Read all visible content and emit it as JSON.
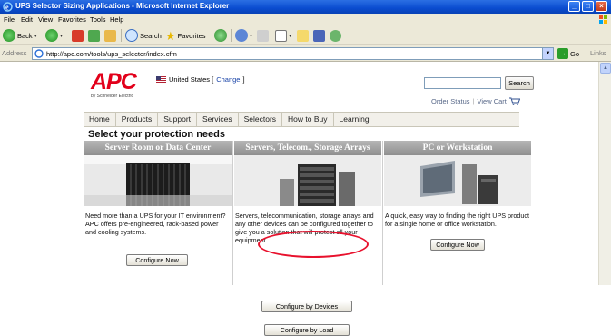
{
  "window": {
    "title": "UPS Selector Sizing Applications - Microsoft Internet Explorer"
  },
  "menu": [
    "File",
    "Edit",
    "View",
    "Favorites",
    "Tools",
    "Help"
  ],
  "toolbar": {
    "back_label": "Back",
    "search_label": "Search",
    "favorites_label": "Favorites"
  },
  "address": {
    "label": "Address",
    "url": "http://apc.com/tools/ups_selector/index.cfm",
    "go_label": "Go",
    "links_label": "Links"
  },
  "site": {
    "logo_text": "APC",
    "logo_byline": "by Schneider Electric",
    "region_label": "United States [",
    "region_link": "Change",
    "region_close": "]",
    "search_button": "Search",
    "order_status": "Order Status",
    "view_cart": "View Cart"
  },
  "nav": [
    "Home",
    "Products",
    "Support",
    "Services",
    "Selectors",
    "How to Buy",
    "Learning"
  ],
  "heading": "Select your protection needs",
  "cards": [
    {
      "title": "Server Room or Data Center",
      "description": "Need more than a UPS for your IT environment? APC offers pre-engineered, rack-based power and cooling systems.",
      "button": "Configure Now"
    },
    {
      "title": "Servers, Telecom., Storage Arrays",
      "description": "Servers, telecommunication, storage arrays and any other devices can be configured together to give you a solution that will protect all your equipment.",
      "button": "Configure by Devices",
      "button2": "Configure by Load"
    },
    {
      "title": "PC or Workstation",
      "description": "A quick, easy way to finding the right UPS product for a single home or office workstation.",
      "button": "Configure Now"
    }
  ],
  "colors": {
    "apc_red": "#e2001a",
    "title_bar_blue": "#0a4cd0",
    "highlight_red": "#e8112d"
  }
}
